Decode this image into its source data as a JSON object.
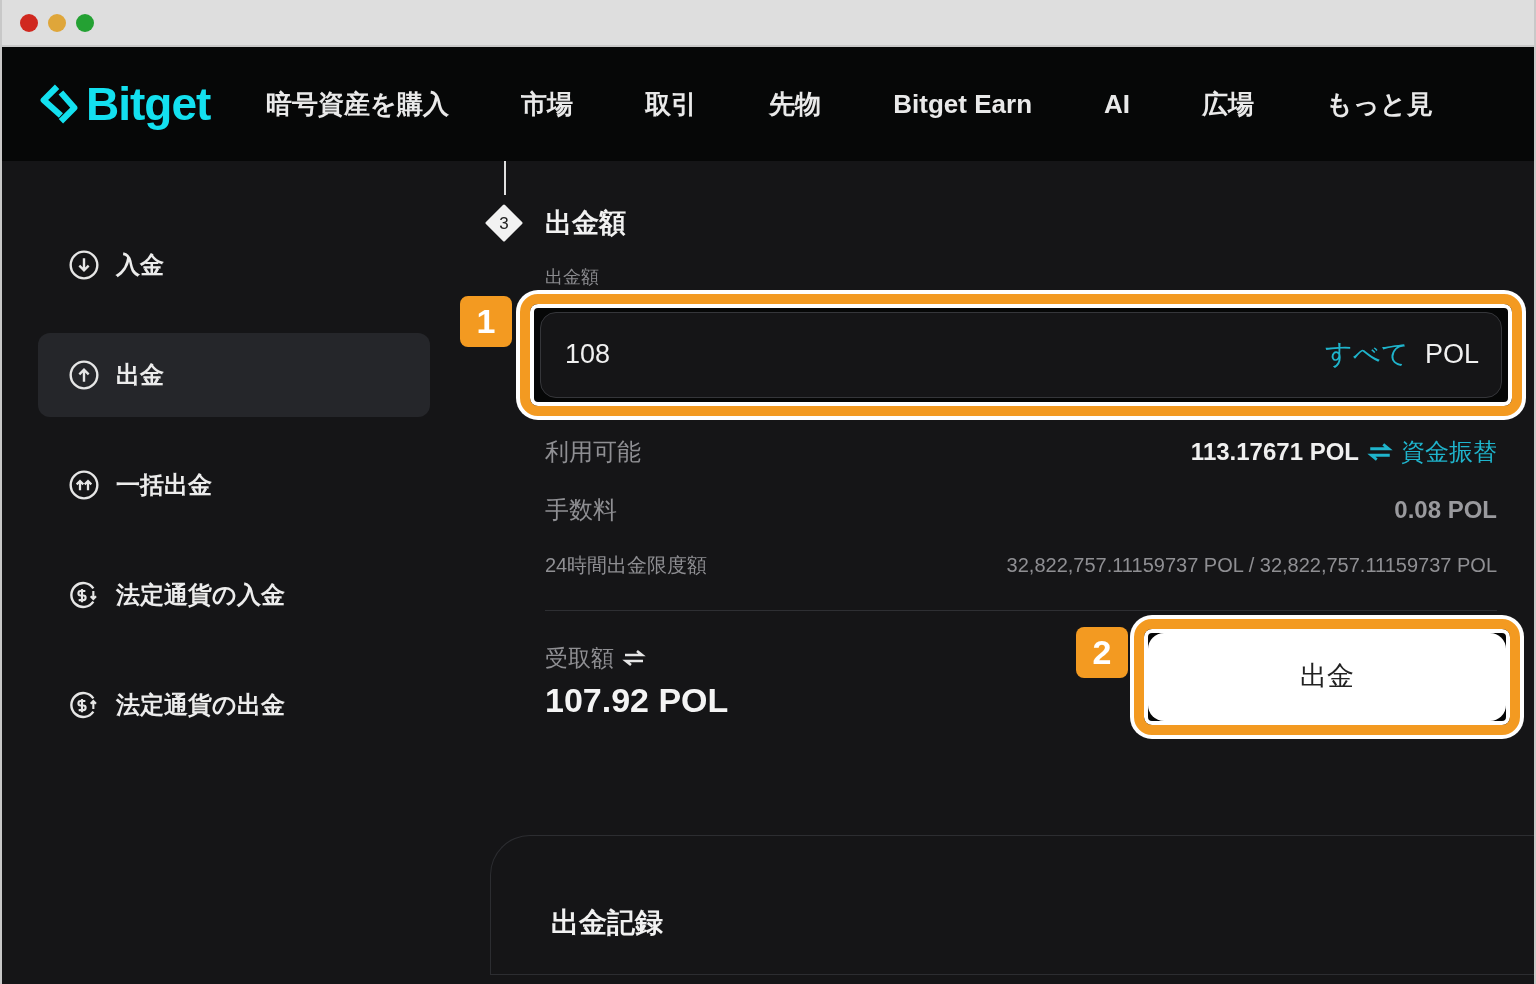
{
  "window": {
    "controls": [
      {
        "color": "#d0281f"
      },
      {
        "color": "#dfa63a"
      },
      {
        "color": "#24a133"
      }
    ]
  },
  "navbar": {
    "logo": "Bitget",
    "items": [
      "暗号資産を購入",
      "市場",
      "取引",
      "先物",
      "Bitget Earn",
      "AI",
      "広場",
      "もっと見"
    ]
  },
  "sidebar": {
    "items": [
      {
        "label": "入金",
        "kind": "deposit",
        "selected": false
      },
      {
        "label": "出金",
        "kind": "withdraw",
        "selected": true
      },
      {
        "label": "一括出金",
        "kind": "batch",
        "selected": false
      },
      {
        "label": "法定通貨の入金",
        "kind": "fiat_deposit",
        "selected": false
      },
      {
        "label": "法定通貨の出金",
        "kind": "fiat_withdraw",
        "selected": false
      }
    ]
  },
  "withdraw_form": {
    "step": "3",
    "title": "出金額",
    "amount_label": "出金額",
    "amount_input": {
      "value": "108",
      "max_link": "すべて",
      "unit": "POL"
    },
    "rows": [
      {
        "kind": "available",
        "label": "利用可能",
        "value": "113.17671 POL",
        "link": "資金振替"
      },
      {
        "kind": "fee",
        "label": "手数料",
        "value": "0.08 POL"
      },
      {
        "kind": "limit",
        "label": "24時間出金限度額",
        "value": "32,822,757.11159737 POL / 32,822,757.11159737 POL"
      }
    ],
    "receive_label": "受取額",
    "receive_amount": "107.92 POL",
    "submit_button": "出金"
  },
  "annotations": [
    {
      "number": "1"
    },
    {
      "number": "2"
    }
  ],
  "records": {
    "title": "出金記録"
  }
}
